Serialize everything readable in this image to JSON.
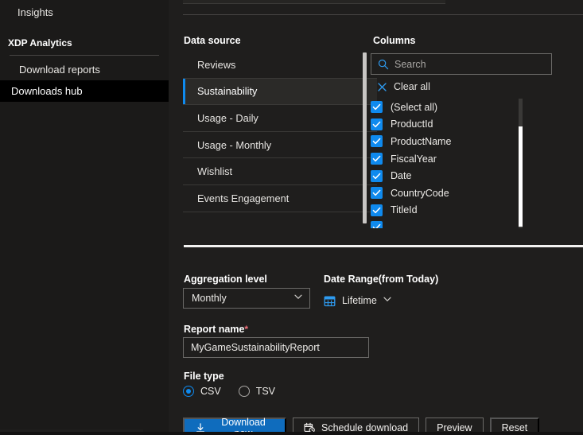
{
  "sidebar": {
    "insights_label": "Insights",
    "section_title": "XDP Analytics",
    "items": [
      {
        "label": "Download reports",
        "selected": false
      },
      {
        "label": "Downloads hub",
        "selected": true
      }
    ]
  },
  "data_source": {
    "label": "Data source",
    "items": [
      {
        "label": "Reviews",
        "selected": false
      },
      {
        "label": "Sustainability",
        "selected": true
      },
      {
        "label": "Usage - Daily",
        "selected": false
      },
      {
        "label": "Usage - Monthly",
        "selected": false
      },
      {
        "label": "Wishlist",
        "selected": false
      },
      {
        "label": "Events Engagement",
        "selected": false
      }
    ]
  },
  "columns": {
    "label": "Columns",
    "search": {
      "value": "",
      "placeholder": "Search",
      "icon": "search-icon"
    },
    "clear_all": {
      "label": "Clear all",
      "icon": "close-icon"
    },
    "items": [
      {
        "label": "(Select all)",
        "checked": true
      },
      {
        "label": "ProductId",
        "checked": true
      },
      {
        "label": "ProductName",
        "checked": true
      },
      {
        "label": "FiscalYear",
        "checked": true
      },
      {
        "label": "Date",
        "checked": true
      },
      {
        "label": "CountryCode",
        "checked": true
      },
      {
        "label": "TitleId",
        "checked": true
      }
    ]
  },
  "settings": {
    "aggregation": {
      "label": "Aggregation level",
      "value": "Monthly"
    },
    "date_range": {
      "label": "Date Range(from Today)",
      "value": "Lifetime",
      "icon": "calendar-icon"
    },
    "report_name": {
      "label": "Report name",
      "required_marker": "*",
      "value": "MyGameSustainabilityReport",
      "placeholder": ""
    },
    "file_type": {
      "label": "File type",
      "options": [
        {
          "label": "CSV",
          "selected": true
        },
        {
          "label": "TSV",
          "selected": false
        }
      ]
    }
  },
  "actions": {
    "download_now": {
      "label": "Download now",
      "icon": "download-icon"
    },
    "schedule_download": {
      "label": "Schedule download",
      "icon": "calendar-clock-icon"
    },
    "preview": {
      "label": "Preview"
    },
    "reset": {
      "label": "Reset"
    }
  },
  "colors": {
    "accent": "#0f8aee",
    "primary_button": "#0f6cbd",
    "background": "#1f1e1d",
    "sidebar_background": "#1b1a19",
    "required": "#f1707b"
  }
}
